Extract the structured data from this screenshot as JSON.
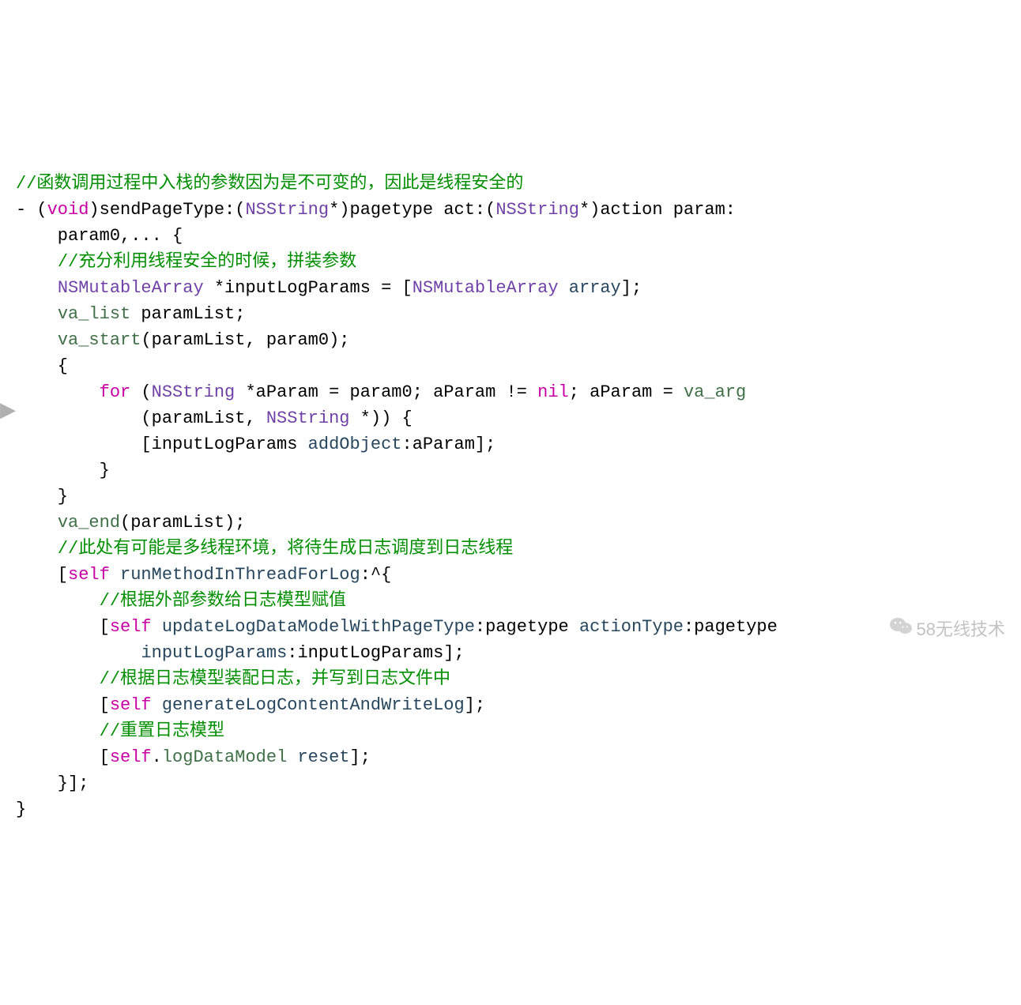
{
  "colors": {
    "comment": "#008f00",
    "keyword": "#c800a4",
    "type": "#6f41a7",
    "method": "#26465d",
    "member": "#3f7047",
    "plain": "#000000"
  },
  "watermark": {
    "text": "58无线技术"
  },
  "code": {
    "tokens": [
      [
        [
          "c",
          "//函数调用过程中入栈的参数因为是不可变的，因此是线程安全的"
        ]
      ],
      [
        [
          "pl",
          "- ("
        ],
        [
          "kw",
          "void"
        ],
        [
          "pl",
          ")sendPageType:("
        ],
        [
          "ty",
          "NSString"
        ],
        [
          "pl",
          "*)pagetype act:("
        ],
        [
          "ty",
          "NSString"
        ],
        [
          "pl",
          "*)action param:"
        ]
      ],
      [
        [
          "pl",
          "    param0,... {"
        ]
      ],
      [
        [
          "pl",
          "    "
        ],
        [
          "c",
          "//充分利用线程安全的时候，拼装参数"
        ]
      ],
      [
        [
          "pl",
          "    "
        ],
        [
          "ty",
          "NSMutableArray"
        ],
        [
          "pl",
          " *inputLogParams = ["
        ],
        [
          "ty",
          "NSMutableArray"
        ],
        [
          "pl",
          " "
        ],
        [
          "fn",
          "array"
        ],
        [
          "pl",
          "];"
        ]
      ],
      [
        [
          "pl",
          "    "
        ],
        [
          "mbr",
          "va_list"
        ],
        [
          "pl",
          " paramList;"
        ]
      ],
      [
        [
          "pl",
          "    "
        ],
        [
          "mbr",
          "va_start"
        ],
        [
          "pl",
          "(paramList, param0);"
        ]
      ],
      [
        [
          "pl",
          "    {"
        ]
      ],
      [
        [
          "pl",
          "        "
        ],
        [
          "kw",
          "for"
        ],
        [
          "pl",
          " ("
        ],
        [
          "ty",
          "NSString"
        ],
        [
          "pl",
          " *aParam = param0; aParam != "
        ],
        [
          "kw",
          "nil"
        ],
        [
          "pl",
          "; aParam = "
        ],
        [
          "mbr",
          "va_arg"
        ]
      ],
      [
        [
          "pl",
          "            (paramList, "
        ],
        [
          "ty",
          "NSString"
        ],
        [
          "pl",
          " *)) {"
        ]
      ],
      [
        [
          "pl",
          "            [inputLogParams "
        ],
        [
          "fn",
          "addObject"
        ],
        [
          "pl",
          ":aParam];"
        ]
      ],
      [
        [
          "pl",
          "        }"
        ]
      ],
      [
        [
          "pl",
          "    }"
        ]
      ],
      [
        [
          "pl",
          "    "
        ],
        [
          "mbr",
          "va_end"
        ],
        [
          "pl",
          "(paramList);"
        ]
      ],
      [
        [
          "pl",
          "    "
        ],
        [
          "c",
          "//此处有可能是多线程环境，将待生成日志调度到日志线程"
        ]
      ],
      [
        [
          "pl",
          "    ["
        ],
        [
          "kw",
          "self"
        ],
        [
          "pl",
          " "
        ],
        [
          "fn",
          "runMethodInThreadForLog"
        ],
        [
          "pl",
          ":^{"
        ]
      ],
      [
        [
          "pl",
          "        "
        ],
        [
          "c",
          "//根据外部参数给日志模型赋值"
        ]
      ],
      [
        [
          "pl",
          "        ["
        ],
        [
          "kw",
          "self"
        ],
        [
          "pl",
          " "
        ],
        [
          "fn",
          "updateLogDataModelWithPageType"
        ],
        [
          "pl",
          ":pagetype "
        ],
        [
          "fn",
          "actionType"
        ],
        [
          "pl",
          ":pagetype"
        ]
      ],
      [
        [
          "pl",
          "            "
        ],
        [
          "fn",
          "inputLogParams"
        ],
        [
          "pl",
          ":inputLogParams];"
        ]
      ],
      [
        [
          "pl",
          "        "
        ],
        [
          "c",
          "//根据日志模型装配日志，并写到日志文件中"
        ]
      ],
      [
        [
          "pl",
          "        ["
        ],
        [
          "kw",
          "self"
        ],
        [
          "pl",
          " "
        ],
        [
          "fn",
          "generateLogContentAndWriteLog"
        ],
        [
          "pl",
          "];"
        ]
      ],
      [
        [
          "pl",
          "        "
        ],
        [
          "c",
          "//重置日志模型"
        ]
      ],
      [
        [
          "pl",
          "        ["
        ],
        [
          "kw",
          "self"
        ],
        [
          "pl",
          "."
        ],
        [
          "mbr",
          "logDataModel"
        ],
        [
          "pl",
          " "
        ],
        [
          "fn",
          "reset"
        ],
        [
          "pl",
          "];"
        ]
      ],
      [
        [
          "pl",
          "    }];"
        ]
      ],
      [
        [
          "pl",
          "}"
        ]
      ]
    ]
  }
}
